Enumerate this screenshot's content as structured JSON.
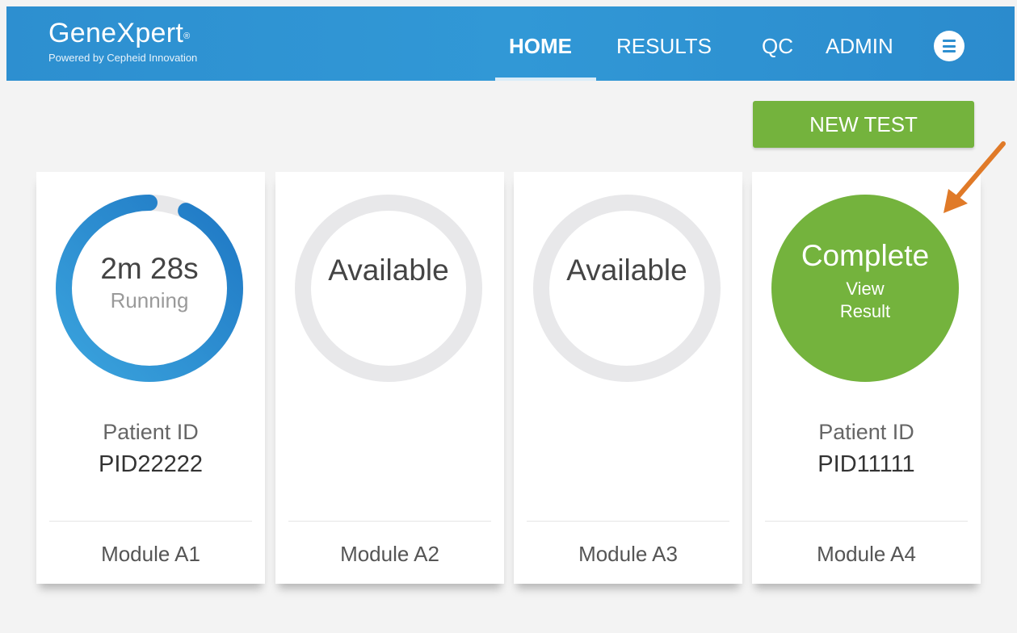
{
  "header": {
    "logo_name": "GeneXpert",
    "logo_mark": "®",
    "logo_tagline": "Powered by Cepheid Innovation",
    "nav": [
      {
        "label": "HOME",
        "active": true
      },
      {
        "label": "RESULTS",
        "active": false
      },
      {
        "label": "QC",
        "active": false
      },
      {
        "label": "ADMIN",
        "active": false
      }
    ],
    "menu_icon": "menu-icon"
  },
  "new_test_label": "NEW TEST",
  "modules": [
    {
      "status_main": "2m 28s",
      "status_sub": "Running",
      "progress": 0.93,
      "patient_label": "Patient ID",
      "patient_id": "PID22222",
      "name": "Module A1"
    },
    {
      "status_main": "Available",
      "status_sub": "",
      "progress": 0,
      "patient_label": "",
      "patient_id": "",
      "name": "Module A2"
    },
    {
      "status_main": "Available",
      "status_sub": "",
      "progress": 0,
      "patient_label": "",
      "patient_id": "",
      "name": "Module A3"
    },
    {
      "status_main": "Complete",
      "status_sub": "View\nResult",
      "progress": 1,
      "patient_label": "Patient ID",
      "patient_id": "PID11111",
      "name": "Module A4"
    }
  ],
  "colors": {
    "header_blue": "#2d8fd0",
    "running_blue": "#2f8fd2",
    "complete_green": "#74b33d",
    "ring_gray": "#e8e8ea",
    "annotation_arrow": "#e07a28"
  }
}
